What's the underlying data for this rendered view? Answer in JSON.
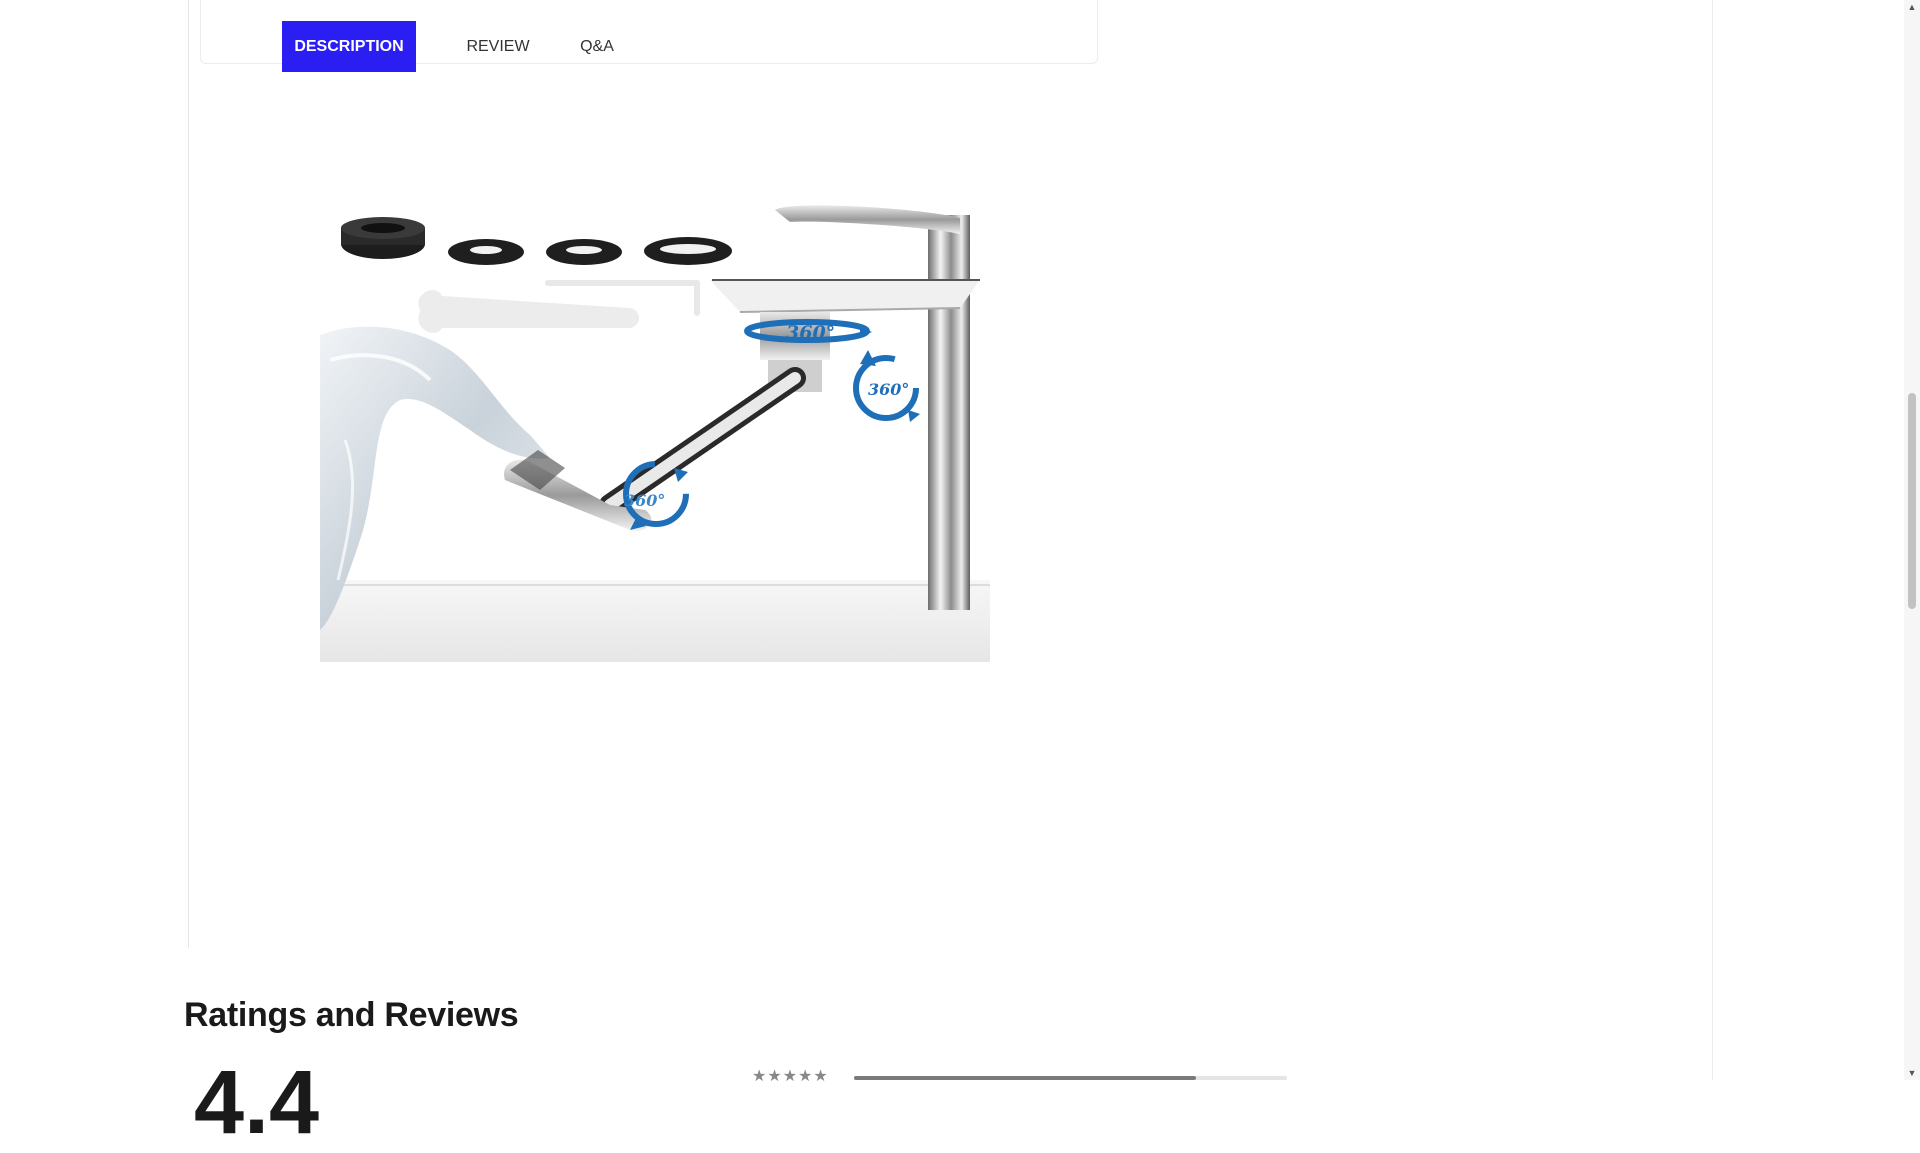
{
  "tabs": {
    "description": "DESCRIPTION",
    "review": "REVIEW",
    "qa": "Q&A",
    "active": "description"
  },
  "product_image": {
    "alt": "Rotating faucet extender with 360° swivel joints and accessories",
    "rotation_labels": [
      "360°",
      "360°",
      "360°"
    ]
  },
  "reviews": {
    "heading": "Ratings and Reviews",
    "average_rating_partial": "4.4",
    "first_star_row": "★★★★★",
    "first_bar_fraction": 0.79
  },
  "colors": {
    "active_tab": "#2a1ef3",
    "rotation_blue": "#1f6fb8"
  },
  "scrollbar": {
    "up_arrow": "▲",
    "down_arrow": "▼"
  }
}
